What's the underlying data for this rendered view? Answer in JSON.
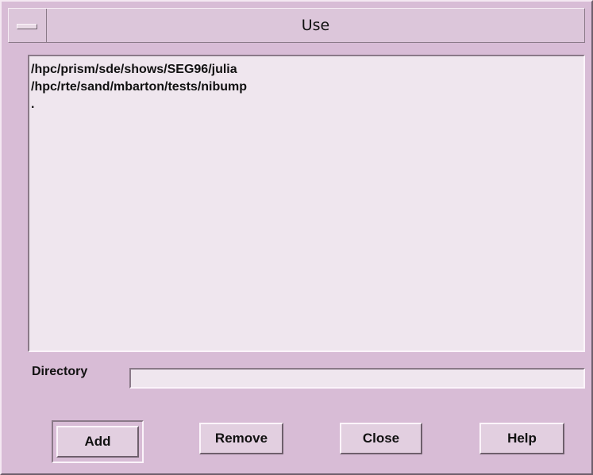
{
  "window": {
    "title": "Use"
  },
  "list": {
    "items": [
      "/hpc/prism/sde/shows/SEG96/julia",
      "/hpc/rte/sand/mbarton/tests/nibump",
      "."
    ]
  },
  "directory": {
    "label": "Directory",
    "value": ""
  },
  "buttons": {
    "add": "Add",
    "remove": "Remove",
    "close": "Close",
    "help": "Help"
  },
  "colors": {
    "background": "#d8bcd6",
    "field": "#efe6ee"
  }
}
